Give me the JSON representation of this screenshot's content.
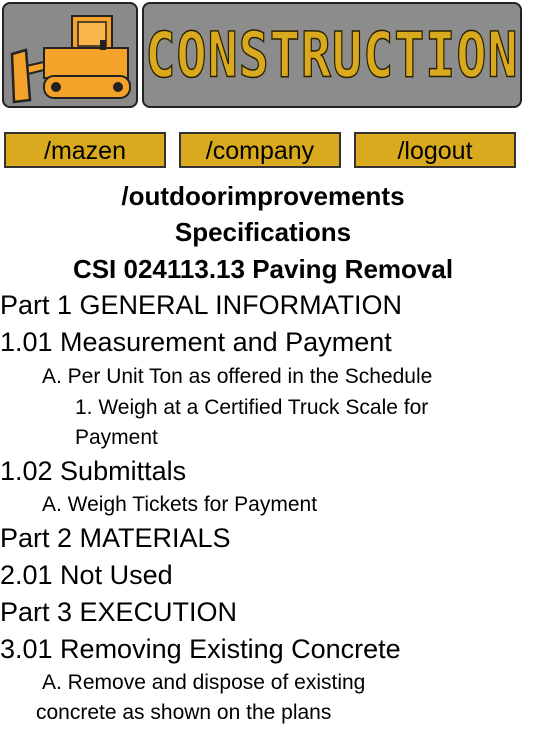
{
  "header": {
    "brand_title": "CONSTRUCTION",
    "logo_icon": "bulldozer-icon",
    "colors": {
      "gold": "#d9a91e",
      "gray": "#8c8c8c",
      "bulldozer_orange": "#f4a22a"
    }
  },
  "nav": [
    {
      "label": "/mazen"
    },
    {
      "label": "/company"
    },
    {
      "label": "/logout"
    }
  ],
  "page": {
    "heading_1": "/outdoorimprovements",
    "heading_2": "Specifications",
    "heading_3": "CSI 024113.13 Paving Removal"
  },
  "spec": {
    "part1": "Part 1 GENERAL INFORMATION",
    "s101": "1.01 Measurement and Payment",
    "s101_a": "A. Per Unit Ton as offered in the Schedule",
    "s101_a1_line1": "1. Weigh at a Certified Truck Scale for",
    "s101_a1_line2": "Payment",
    "s102": "1.02 Submittals",
    "s102_a": "A. Weigh Tickets for Payment",
    "part2": "Part 2 MATERIALS",
    "s201": "2.01 Not Used",
    "part3": "Part 3 EXECUTION",
    "s301": "3.01 Removing Existing Concrete",
    "s301_a_line1": "A. Remove and dispose of existing",
    "s301_a_line2": "concrete as shown on the plans"
  }
}
